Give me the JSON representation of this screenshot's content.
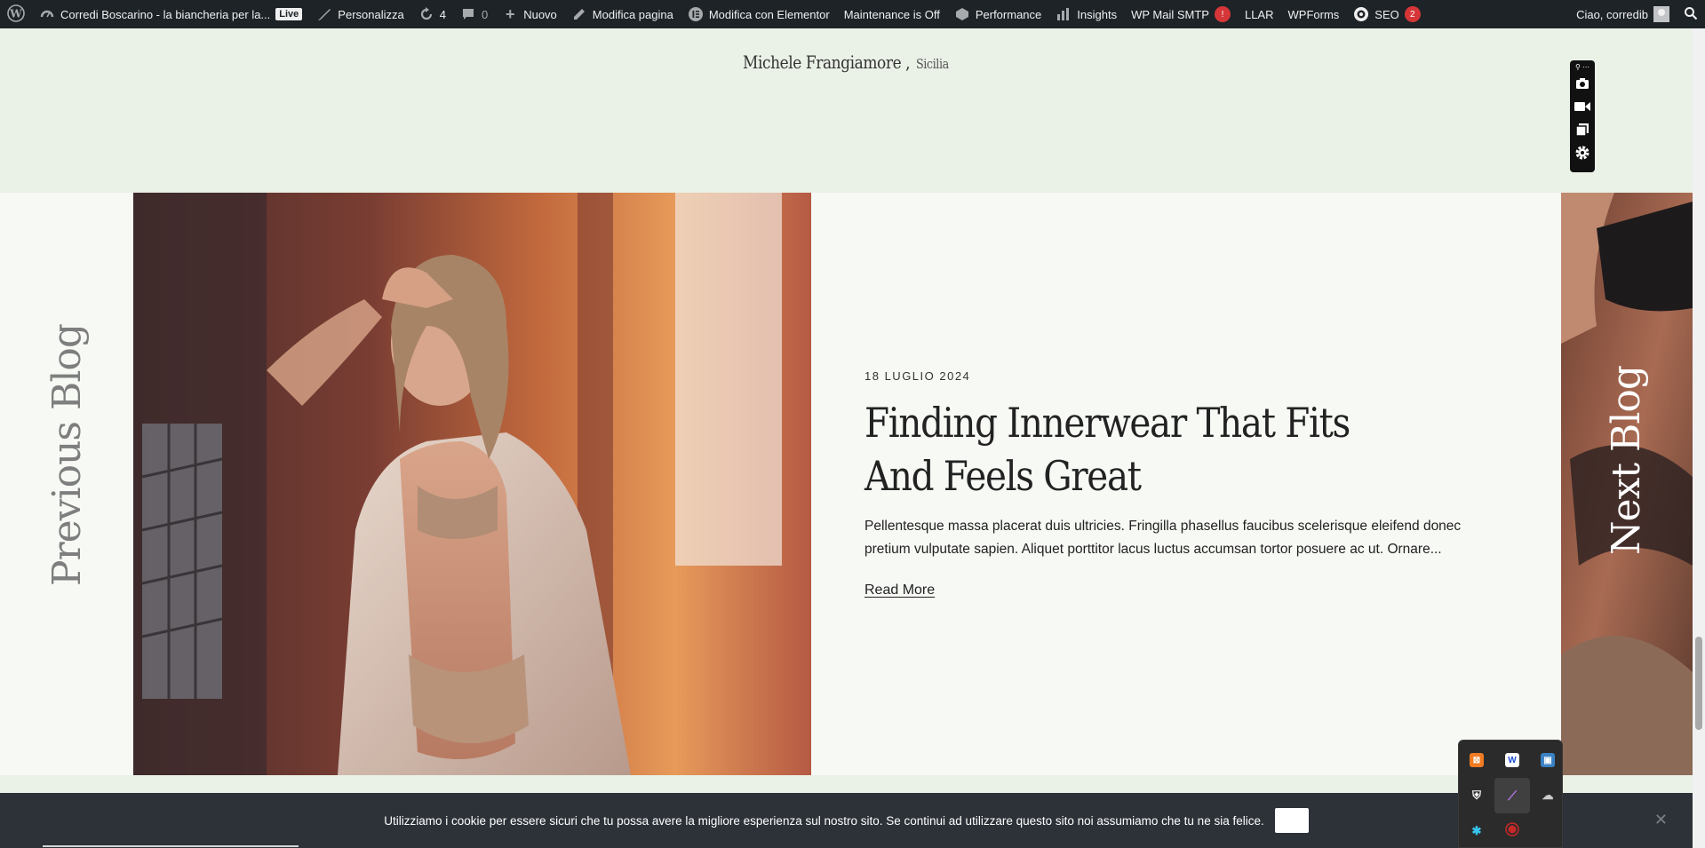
{
  "adminbar": {
    "site_name": "Corredi Boscarino - la biancheria per la...",
    "live_badge": "Live",
    "customize": "Personalizza",
    "updates_count": "4",
    "comments_count": "0",
    "new_label": "Nuovo",
    "edit_page": "Modifica pagina",
    "edit_elementor": "Modifica con Elementor",
    "maintenance": "Maintenance is Off",
    "performance": "Performance",
    "insights": "Insights",
    "wp_mail_smtp": "WP Mail SMTP",
    "wp_mail_smtp_badge": "!",
    "llar": "LLAR",
    "wpforms": "WPForms",
    "seo": "SEO",
    "seo_count": "2",
    "greeting": "Ciao, corredib"
  },
  "header": {
    "author_name": "Michele Frangiamore ,",
    "author_region": "Sicilia"
  },
  "post": {
    "prev_label": "Previous Blog",
    "next_label": "Next Blog",
    "date": "18 LUGLIO 2024",
    "title": "Finding Innerwear That Fits And Feels Great",
    "excerpt": "Pellentesque massa placerat duis ultricies. Fringilla phasellus faucibus scelerisque eleifend donec pretium vulputate sapien. Aliquet porttitor lacus luctus accumsan tortor posuere ac ut. Ornare...",
    "read_more": "Read More"
  },
  "cookie": {
    "text": "Utilizziamo i cookie per essere sicuri che tu possa avere la migliore esperienza sul nostro sito. Se continui ad utilizzare questo sito noi assumiamo che tu ne sia felice.",
    "close_glyph": "✕"
  },
  "colors": {
    "adminbar_bg": "#1d2327",
    "page_bg": "#eaf1e6",
    "post_bg": "#f7f9f4",
    "cookie_bg": "#2c3238",
    "badge_red": "#d63638"
  }
}
